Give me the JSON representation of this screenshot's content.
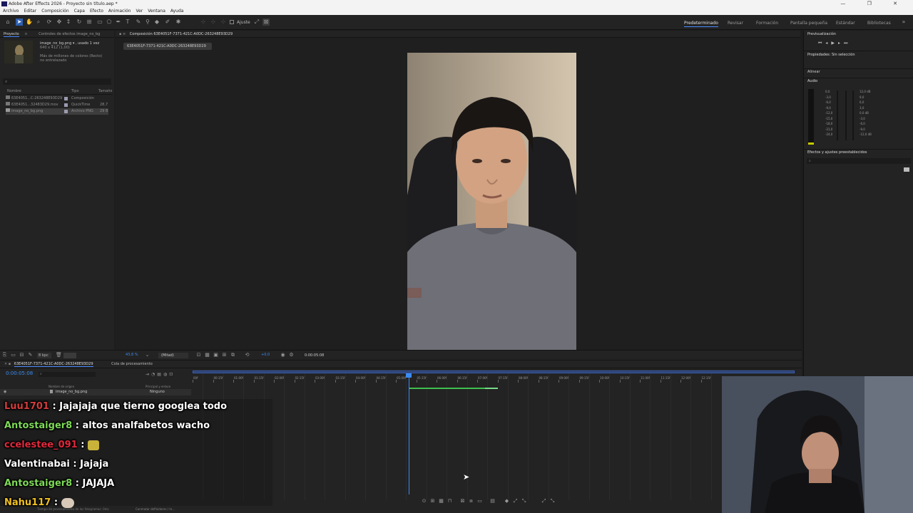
{
  "window": {
    "title": "Adobe After Effects 2026 - Proyecto sin título.aep *",
    "controls": [
      "—",
      "❐",
      "✕"
    ]
  },
  "menu": [
    "Archivo",
    "Editar",
    "Composición",
    "Capa",
    "Efecto",
    "Animación",
    "Ver",
    "Ventana",
    "Ayuda"
  ],
  "toolbar": {
    "snap_label": "Ajuste",
    "workspaces": [
      "Predeterminado",
      "Revisar",
      "Formación",
      "Pantalla pequeña",
      "Estándar",
      "Bibliotecas"
    ],
    "active_workspace": "Predeterminado"
  },
  "project_panel": {
    "tab_label": "Proyecto",
    "effects_tab": "Controles de efectos image_no_bg",
    "item_name": "image_no_bg.png ▾ , usado 1 vez",
    "item_dims": "640 x 412 (1,00)",
    "item_colors": "Más de millones de colores (Recto)",
    "item_interlace": "no entrelazado",
    "search_placeholder": "⌕",
    "columns": [
      "Nombre",
      "Tipo",
      "Tamaño"
    ],
    "rows": [
      {
        "name": "63E4051...C-263248E93D29",
        "type": "Composición",
        "size": ""
      },
      {
        "name": "63E4051...32483D29.mov",
        "type": "QuickTime",
        "size": "28,7"
      },
      {
        "name": "image_no_bg.png",
        "type": "Archivo PNG",
        "size": "29 B"
      }
    ]
  },
  "composition": {
    "panel_title": "Composición 63E4051F-7371-421C-A0DC-263248E93D29",
    "tab_label": "63E4051F-7371-421C-A0DC-263248E93D29"
  },
  "viewer_bar": {
    "bpc": "8 bpc",
    "zoom": "43,8 %",
    "resolution": "(Mitad)",
    "exposure": "+0,0",
    "timecode": "0:00:05:08"
  },
  "right_panel": {
    "preview_title": "Previsualización",
    "properties_title": "Propiedades: Sin selección",
    "align_title": "Alinear",
    "audio_title": "Audio",
    "audio_left_scale": [
      "0,0",
      "-3,0",
      "-6,0",
      "-9,0",
      "-12,0",
      "-15,0",
      "-18,0",
      "-21,0",
      "-24,0"
    ],
    "audio_right_scale": [
      "12,0 dB",
      "9,0",
      "6,0",
      "3,0",
      "0,0 dB",
      "-3,0",
      "-6,0",
      "-9,0",
      "-12,0 dB"
    ],
    "effects_title": "Efectos y ajustes preestablecidos",
    "effects_search": "⌕"
  },
  "timeline": {
    "comp_tab": "63E4051F-7371-421C-A0DC-263248E93D29",
    "render_tab": "Cola de procesamiento",
    "current_time": "0:00:05:08",
    "col_source": "Nombre de origen",
    "col_parent": "Principal y enlace",
    "layer_name": "image_no_bg.png",
    "parent_value": "Ninguno",
    "ruler": [
      "00f",
      "00:15f",
      "01:00f",
      "01:15f",
      "02:00f",
      "02:15f",
      "03:00f",
      "03:15f",
      "04:00f",
      "04:15f",
      "05:00f",
      "05:15f",
      "06:00f",
      "06:15f",
      "07:00f",
      "07:15f",
      "08:00f",
      "08:15f",
      "09:00f",
      "09:15f",
      "10:00f",
      "10:15f",
      "11:00f",
      "11:15f",
      "12:00f",
      "12:15f"
    ],
    "footer_left": "Tiempo de procesamiento de los fotogramas: 0ms",
    "footer_mid": "Conmutar definidores / m..."
  },
  "chat": [
    {
      "user": "Luu1701",
      "user_color": "#d43c3c",
      "text": ": Jajajaja que tierno googlea todo"
    },
    {
      "user": "Antostaiger8",
      "user_color": "#7ed957",
      "text": ": altos analfabetos wacho"
    },
    {
      "user": "ccelestee_091",
      "user_color": "#e0283c",
      "text": ":"
    },
    {
      "user": "Valentinabai",
      "user_color": "#ffffff",
      "text": ": Jajaja"
    },
    {
      "user": "Antostaiger8",
      "user_color": "#7ed957",
      "text": ": JAJAJA"
    },
    {
      "user": "Nahu117",
      "user_color": "#f0c020",
      "text": ":"
    }
  ],
  "colors": {
    "accent": "#3b8cf0",
    "panel": "#232323",
    "bg": "#1d1d1d",
    "green_bar": "#3fbf4f"
  }
}
